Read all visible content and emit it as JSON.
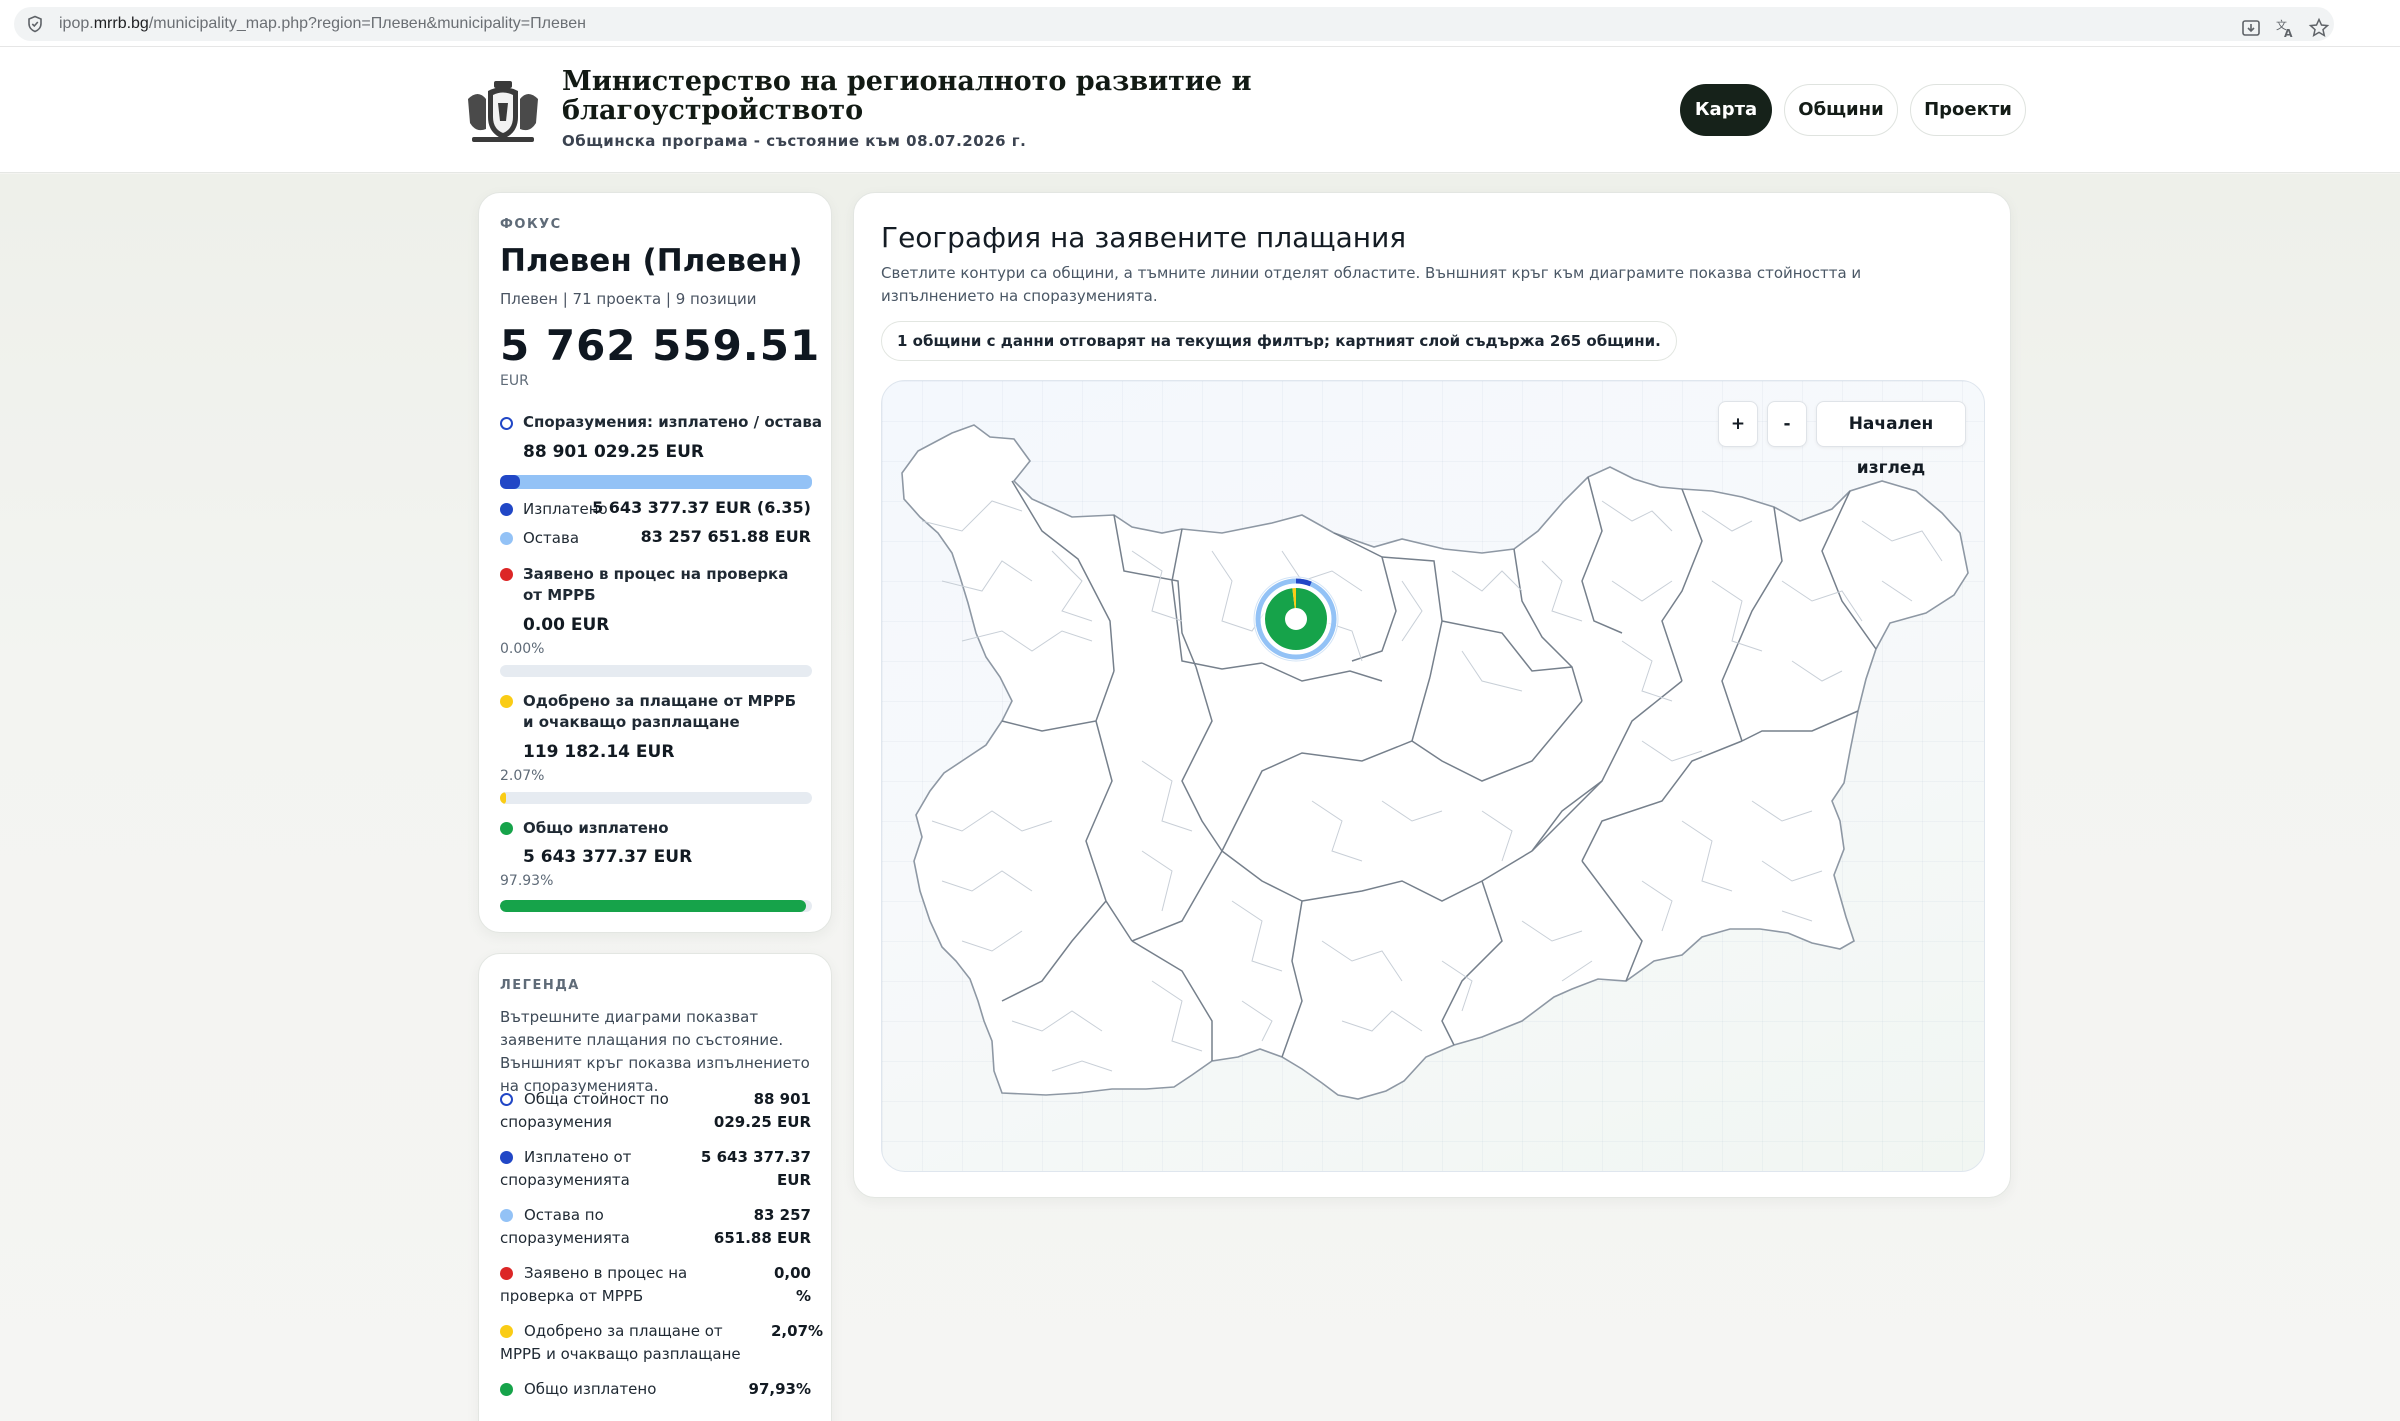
{
  "browser": {
    "url_prefix": "ipop.",
    "url_host": "mrrb.bg",
    "url_rest": "/municipality_map.php?region=Плевен&municipality=Плевен"
  },
  "header": {
    "title_line1": "Министерство на регионалното развитие и",
    "title_line2": "благоустройството",
    "subtitle": "Общинска програма - състояние към 08.07.2026 г.",
    "nav": {
      "map": "Карта",
      "municipalities": "Общини",
      "projects": "Проекти"
    }
  },
  "focus": {
    "caption": "ФОКУС",
    "name": "Плевен (Плевен)",
    "meta": "Плевен | 71 проекта | 9 позиции",
    "amount": "5 762 559.51",
    "currency": "EUR",
    "agreements_label": "Споразумения: изплатено / остава",
    "agreements_value": "88 901 029.25 EUR",
    "agreements_paid_fraction": 0.0635,
    "paid_label": "Изплатено",
    "paid_value": "5 643 377.37 EUR (6.35)",
    "remaining_label": "Остава",
    "remaining_value": "83 257 651.88 EUR",
    "review_label": "Заявено в процес на проверка от МРРБ",
    "review_value": "0.00 EUR",
    "review_pct": "0.00%",
    "review_fraction": 0.0,
    "approved_label": "Одобрено за плащане от МРРБ и очакващо разплащане",
    "approved_value": "119 182.14 EUR",
    "approved_pct": "2.07%",
    "approved_fraction": 0.0207,
    "total_label": "Общо изплатено",
    "total_value": "5 643 377.37 EUR",
    "total_pct": "97.93%",
    "total_fraction": 0.9793
  },
  "legend": {
    "caption": "ЛЕГЕНДА",
    "description": "Вътрешните диаграми показват заявените плащания по състояние. Външният кръг показва изпълнението на споразуменията.",
    "rows": [
      {
        "label": "Обща стойност по споразумения",
        "value": "88 901 029.25 EUR"
      },
      {
        "label": "Изплатено от споразуменията",
        "value": "5 643 377.37 EUR"
      },
      {
        "label": "Остава по споразуменията",
        "value": "83 257 651.88 EUR"
      },
      {
        "label": "Заявено в процес на проверка от МРРБ",
        "value": "0,00 %"
      },
      {
        "label": "Одобрено за плащане от МРРБ и очакващо разплащане",
        "value": "2,07%"
      },
      {
        "label": "Общо изплатено",
        "value": "97,93%"
      }
    ]
  },
  "map": {
    "title": "География на заявените плащания",
    "description": "Светлите контури са общини, а тъмните линии отделят областите. Външният кръг към диаграмите показва стойността и изпълнението на споразуменията.",
    "filter_note": "1 общини с данни отговарят на текущия филтър; картният слой съдържа 265 общини.",
    "zoom_in": "+",
    "zoom_out": "-",
    "reset": "Начален изглед"
  },
  "colors": {
    "ring": "#2147c6",
    "paid": "#2147c6",
    "remaining": "#93c2f6",
    "review": "#dc2626",
    "approved": "#facc15",
    "total": "#16a34a",
    "nav_active": "#16221a"
  }
}
